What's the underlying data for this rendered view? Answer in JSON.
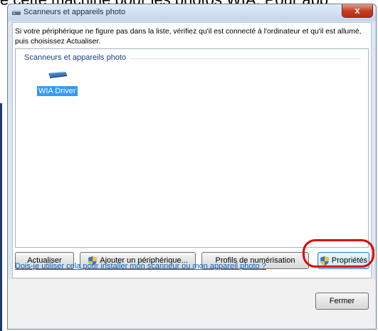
{
  "background": {
    "caption": "e cette machine pour les photos WIA. Pour app"
  },
  "window": {
    "title": "Scanneurs et appareils photo",
    "close_label": "x",
    "intro_text": "Si votre périphérique ne figure pas dans la liste, vérifiez qu'il est connecté à l'ordinateur et qu'il est allumé, puis choisissez Actualiser.",
    "group_label": "Scanneurs et appareils photo",
    "devices": [
      {
        "label": "WIA Driver",
        "icon": "scanner-icon",
        "selected": true
      }
    ],
    "buttons": {
      "refresh": "Actualiser",
      "add_device": "Ajouter un périphérique...",
      "scan_profiles": "Profils de numérisation",
      "properties": "Propriétés",
      "close": "Fermer"
    },
    "help_link": "Dois-je utiliser cela pour installer mon scanneur ou mon appareil photo ?"
  },
  "colors": {
    "highlight": "#e00000",
    "selection": "#3399ff",
    "link": "#0066cc",
    "close_button": "#c43b1d"
  }
}
